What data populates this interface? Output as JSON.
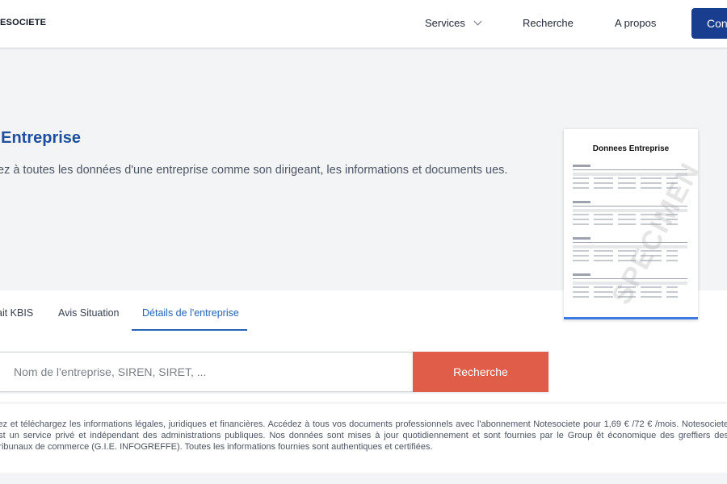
{
  "header": {
    "logo": "ESOCIETE",
    "nav": {
      "services": "Services",
      "recherche": "Recherche",
      "apropos": "A propos"
    },
    "connect_label": "Con"
  },
  "hero": {
    "title": "l Entreprise",
    "description": "ez à toutes les données d'une entreprise comme son dirigeant, les informations et documents ues."
  },
  "document_preview": {
    "title": "Donnees Entreprise",
    "watermark": "SPECIMEN"
  },
  "tabs": [
    {
      "label": "ait KBIS",
      "active": false
    },
    {
      "label": "Avis Situation",
      "active": false
    },
    {
      "label": "Détails de l'entreprise",
      "active": true
    }
  ],
  "search": {
    "placeholder": "Nom de l'entreprise, SIREN, SIRET, ...",
    "button_label": "Recherche"
  },
  "info_text": "itez et téléchargez les informations légales, juridiques et financières. Accédez à tous vos documents professionnels avec l'abonnement Notesociete pour 1,69 € /72 € /mois. Notesociete est un service privé et indépendant des administrations publiques. Nos données sont mises à jour quotidiennement et sont fournies par le Group êt économique des greffiers des Tribunaux de commerce (G.I.E. INFOGREFFE). Toutes les informations fournies sont authentiques et certifiées.",
  "colors": {
    "brand_blue": "#1a3e8f",
    "title_blue": "#1f4f9c",
    "tab_active": "#2563b7",
    "search_button": "#e05d4a",
    "hero_bg": "#f3f4f6"
  }
}
